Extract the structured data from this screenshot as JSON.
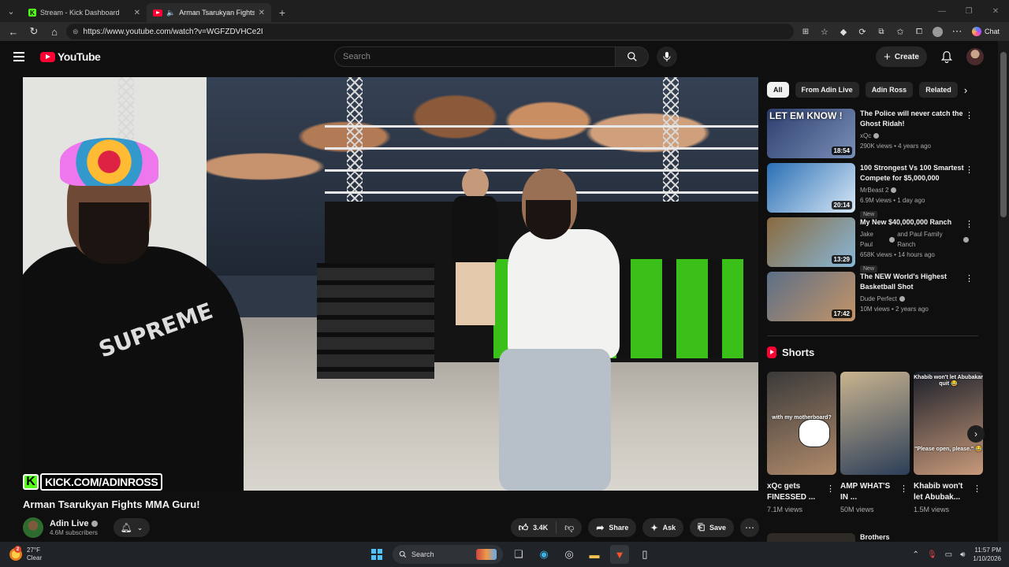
{
  "browser": {
    "tabs": [
      {
        "title": "Stream - Kick Dashboard",
        "active": false
      },
      {
        "title": "Arman Tsarukyan Fights MMA Guru!",
        "active": true
      }
    ],
    "url": "https://www.youtube.com/watch?v=WGFZDVHCe2I",
    "chat_label": "Chat"
  },
  "header": {
    "logo_text": "YouTube",
    "search_placeholder": "Search",
    "create_label": "Create"
  },
  "video": {
    "watermark_text": "KICK.COM/ADINROSS",
    "shirt_text": "SUPREME",
    "title": "Arman Tsarukyan Fights MMA Guru!",
    "channel_name": "Adin Live",
    "subscribers": "4.6M subscribers",
    "likes": "3.4K",
    "share_label": "Share",
    "ask_label": "Ask",
    "save_label": "Save"
  },
  "chips": [
    {
      "label": "All",
      "active": true
    },
    {
      "label": "From Adin Live",
      "active": false
    },
    {
      "label": "Adin Ross",
      "active": false
    },
    {
      "label": "Related",
      "active": false
    }
  ],
  "recommendations": [
    {
      "title": "The Police will never catch the Ghost Ridah!",
      "channel": "xQc",
      "channel_extra": "",
      "meta": "290K views • 4 years ago",
      "duration": "18:54",
      "new": "",
      "thumb_text": "LET EM KNOW !",
      "thumb_colors": [
        "#2c3e6e",
        "#7a8fb8"
      ]
    },
    {
      "title": "100 Strongest Vs 100 Smartest Compete for $5,000,000",
      "channel": "MrBeast 2",
      "channel_extra": "",
      "meta": "6.9M views • 1 day ago",
      "duration": "20:14",
      "new": "New",
      "thumb_text": "",
      "thumb_colors": [
        "#2a6fb5",
        "#d8e8f6"
      ]
    },
    {
      "title": "My New $40,000,000 Ranch",
      "channel": "Jake Paul",
      "channel_extra": "and Paul Family Ranch",
      "meta": "658K views • 14 hours ago",
      "duration": "13:29",
      "new": "New",
      "thumb_text": "",
      "thumb_colors": [
        "#8a6a3e",
        "#87b7d9"
      ]
    },
    {
      "title": "The NEW World's Highest Basketball Shot",
      "channel": "Dude Perfect",
      "channel_extra": "",
      "meta": "10M views • 2 years ago",
      "duration": "17:42",
      "new": "",
      "thumb_text": "",
      "thumb_colors": [
        "#5c6f87",
        "#c59466"
      ]
    }
  ],
  "shorts": {
    "heading": "Shorts",
    "items": [
      {
        "title": "xQc gets FINESSED ...",
        "views": "7.1M views",
        "overlay": "with my motherboard?",
        "colors": [
          "#3a3a3a",
          "#b08a6a"
        ]
      },
      {
        "title": "AMP WHAT'S IN ...",
        "views": "50M views",
        "overlay": "",
        "colors": [
          "#c9b48f",
          "#2c3e58"
        ]
      },
      {
        "title": "Khabib won't let Abubak...",
        "views": "1.5M views",
        "overlay": "Khabib won't let Abubakar quit 😂",
        "overlay_bottom": "\"Please open, please.\" 😂",
        "colors": [
          "#1b1f2a",
          "#c89a7a"
        ]
      }
    ]
  },
  "next_item": {
    "title": "Brothers"
  },
  "taskbar": {
    "temp": "27°F",
    "condition": "Clear",
    "search_label": "Search",
    "time": "11:57 PM",
    "date": "1/10/2026",
    "notification_count": "2"
  }
}
